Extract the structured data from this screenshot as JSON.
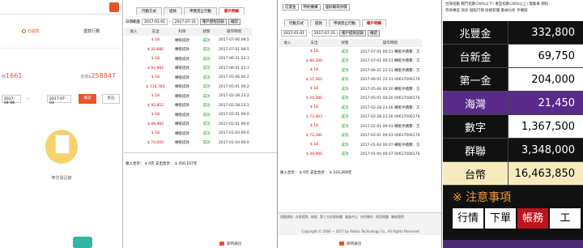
{
  "p1": {
    "tabs": [
      "已提款",
      "匯款行數"
    ],
    "sum_left_label": "時",
    "sum_left_value": "1661",
    "sum_right_label": "金額$",
    "sum_right_value": "258847",
    "date_from": "2017-04-06",
    "date_to": "2017-07-03",
    "query_btn": "確認",
    "reset_btn": "重設",
    "empty_text": "無交易記錄"
  },
  "p2": {
    "tabs": [
      "行動方式",
      "提款",
      "申匯禁止行動",
      "帳戶明細"
    ],
    "from_label": "日期範圍",
    "date_from": "2017-01-01",
    "date_to": "2017-07-31",
    "btn1": "帳戶歷程記錄",
    "btn2": "確認",
    "headers": [
      "收入",
      "支出",
      "科目",
      "狀態",
      "操作時間"
    ],
    "rows": [
      [
        "",
        "$ 18",
        "轉帳提款",
        "成功",
        "2017-07-06 08:5"
      ],
      [
        "",
        "$ 32,680",
        "轉帳提款",
        "成功",
        "2017-07-01 08:5"
      ],
      [
        "",
        "$ 18",
        "轉帳提款",
        "成功",
        "2017-06-21 23:3"
      ],
      [
        "",
        "$ 92,982",
        "轉帳提款",
        "成功",
        "2017-06-01 23:3"
      ],
      [
        "",
        "$ 18",
        "轉帳提款",
        "成功",
        "2017-05-06 00:2"
      ],
      [
        "",
        "$ 114,783",
        "轉帳提款",
        "成功",
        "2017-05-01 00:2"
      ],
      [
        "",
        "$ 18",
        "轉帳提款",
        "成功",
        "2017-02-28 23:2"
      ],
      [
        "",
        "$ 92,852",
        "轉帳提款",
        "成功",
        "2017-02-28 23:2"
      ],
      [
        "",
        "$ 18",
        "轉帳提款",
        "成功",
        "2017-02-01 09:0"
      ],
      [
        "",
        "$ 49,982",
        "轉帳提款",
        "成功",
        "2017-02-01 09:0"
      ],
      [
        "",
        "$ 18",
        "轉帳提款",
        "成功",
        "2017-01-04 00:0"
      ],
      [
        "",
        "$ 74,000",
        "轉帳提款",
        "成功",
        "2017-01-04 00:0"
      ]
    ],
    "total": "收入合計： $ 0元  支出合計： $ 450,107元",
    "chat": "即時通訊"
  },
  "p3": {
    "sel1": "信貸金",
    "sel2": "特約機構",
    "sel3": "理財輔導評價",
    "tabs": [
      "行動方式",
      "提款",
      "申請禁止行動",
      "帳戶明細"
    ],
    "date_from": "2017-01-01",
    "date_to": "2017-07-31",
    "btn1": "帳戶提款記錄",
    "btn2": "確認",
    "headers": [
      "收入",
      "支出",
      "狀態",
      "操作時間"
    ],
    "rows": [
      [
        "",
        "$ 18",
        "成功",
        "2017-07-01 00:51 轉帳手續費：方"
      ],
      [
        "",
        "$ 86,300",
        "成功",
        "2017-07-01 00:51 轉帳手續費：方"
      ],
      [
        "",
        "$ 18",
        "成功",
        "2017-06-21 23:31 轉帳手續費：方"
      ],
      [
        "",
        "$ 57,262",
        "成功",
        "2017-06-01 23:31 00617006176"
      ],
      [
        "",
        "$ 18",
        "成功",
        "2017-05-06 00:20 轉帳手續費：方"
      ],
      [
        "",
        "$ 24,385",
        "成功",
        "2017-05-01 00:20 00617006176"
      ],
      [
        "",
        "$ 18",
        "成功",
        "2017-02-28 23:26 轉帳手續費：方"
      ],
      [
        "",
        "$ 73,463",
        "成功",
        "2017-02-28 23:26 00617006176"
      ],
      [
        "",
        "$ 18",
        "成功",
        "2017-02-01 09:03 轉帳手續費：方"
      ],
      [
        "",
        "$ 72,282",
        "成功",
        "2017-02-01 09:03 00617006176"
      ],
      [
        "",
        "$ 18",
        "成功",
        "2017-01-04 00:07 轉帳手續費：方"
      ],
      [
        "",
        "$ 39,900",
        "成功",
        "2017-01-04 00:07 00617006176"
      ]
    ],
    "total": "收入合計： $ 0元  支出合計： $ 333,269元",
    "footer_links": [
      "遊戲規則",
      "存款提款",
      "帳號",
      "第三方存款授權",
      "會員中心",
      "合作夥伴",
      "常見問題",
      "聯絡我們"
    ],
    "copyright": "Copyright © 2004 ~ 2017 by Addon Technology Co., All Rights Reserved",
    "chat": "即時通訊"
  },
  "p4": {
    "top_lines": [
      "台灣指數 戰鬥指數(28%以下) 重型指數(28%以上) 電動車 期指",
      "券商專區 快訊 個股行情 財經新聞 數據分析 手機版"
    ],
    "stocks": [
      {
        "name": "兆豐金",
        "value": "332,800",
        "style": "dark"
      },
      {
        "name": "台新金",
        "value": "69,750",
        "style": "white"
      },
      {
        "name": "第一金",
        "value": "204,000",
        "style": "white"
      },
      {
        "name": "海灣",
        "value": "21,450",
        "style": "purple"
      },
      {
        "name": "數字",
        "value": "1,367,500",
        "style": "white"
      },
      {
        "name": "群聯",
        "value": "3,348,000",
        "style": "dark"
      },
      {
        "name": "台幣",
        "value": "16,463,850",
        "style": "cream"
      }
    ],
    "notice": "※ 注意事項",
    "tabs": [
      "行情",
      "下單",
      "帳務",
      "工"
    ]
  }
}
